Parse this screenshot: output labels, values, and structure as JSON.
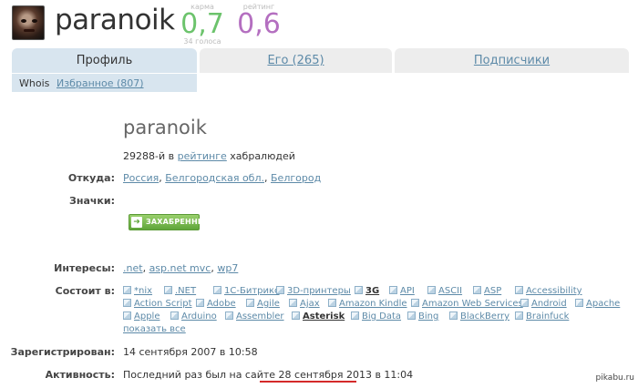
{
  "header": {
    "username": "paranoik",
    "karma": {
      "label": "карма",
      "value": "0,7",
      "votes": "34 голоса"
    },
    "rating": {
      "label": "рейтинг",
      "value": "0,6"
    }
  },
  "tabs": [
    {
      "label": "Профиль",
      "active": true
    },
    {
      "label": "Его (265)",
      "active": false
    },
    {
      "label": "Подписчики",
      "active": false
    }
  ],
  "subtabs": [
    {
      "label": "Whois",
      "active": true
    },
    {
      "label": "Избранное (807)",
      "active": false
    }
  ],
  "profile": {
    "name": "paranoik",
    "rank": {
      "prefix": "29288-й в",
      "link": "рейтинге",
      "suffix": "хабралюдей"
    },
    "from_label": "Откуда:",
    "from": [
      "Россия",
      "Белгородская обл.",
      "Белгород"
    ],
    "badges_label": "Значки:",
    "badge": "ЗАХАБРЕННЫЙ",
    "interests_label": "Интересы:",
    "interests": [
      ".net",
      "asp.net mvc",
      "wp7"
    ],
    "member_label": "Состоит в:",
    "hubs": [
      "*nix",
      ".NET",
      "1С-Битрикс",
      "3D-принтеры",
      "3G",
      "API",
      "ASCII",
      "ASP",
      "Accessibility",
      "Action Script",
      "Adobe",
      "Agile",
      "Ajax",
      "Amazon Kindle",
      "Amazon Web Services",
      "Android",
      "Apache",
      "Apple",
      "Arduino",
      "Assembler",
      "Asterisk",
      "Big Data",
      "Bing",
      "BlackBerry",
      "Brainfuck"
    ],
    "show_all": "показать все",
    "registered_label": "Зарегистрирован:",
    "registered": "14 сентября 2007 в 10:58",
    "activity_label": "Активность:",
    "activity_prefix": "Последний раз был на сайте",
    "activity_date": "28 сентября 2013 в 11:04"
  },
  "accent_colors": {
    "karma": "#6cc36c",
    "rating": "#b46fc0",
    "link": "#5d8aa8",
    "tab_active": "#d8e5ef",
    "highlight": "#d42a2a"
  },
  "watermark": "pikabu.ru"
}
